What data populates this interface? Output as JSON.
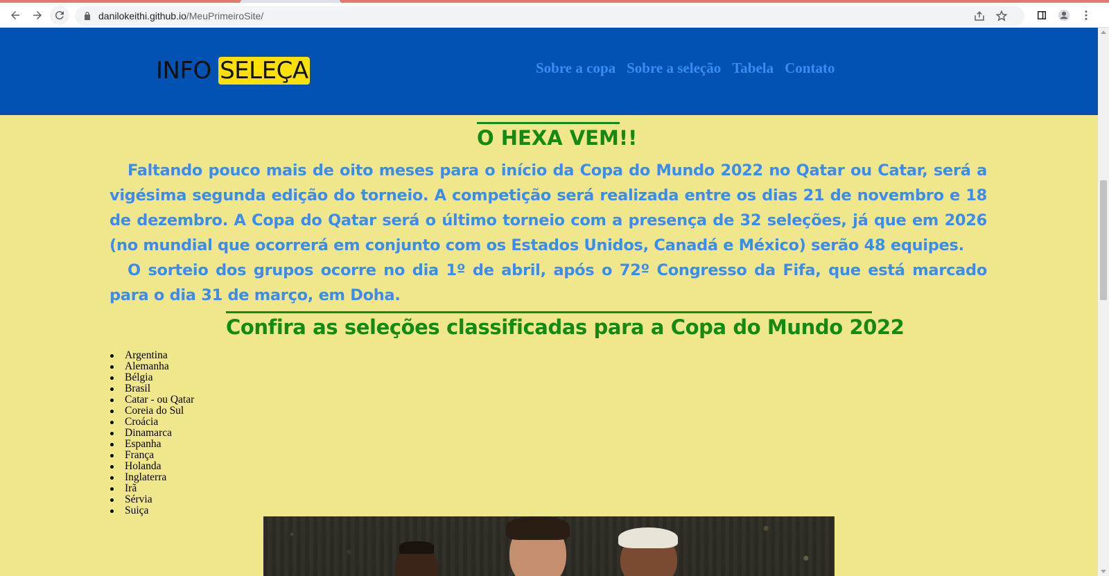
{
  "browser": {
    "url_host": "danilokeithi.github.io",
    "url_path": "/MeuPrimeiroSite/",
    "icons": [
      "back-icon",
      "forward-icon",
      "reload-icon",
      "lock-icon",
      "share-icon",
      "star-icon",
      "side-panel-icon",
      "profile-icon",
      "menu-icon"
    ]
  },
  "header": {
    "logo_plain": "INFO",
    "logo_highlight": "SELEÇA",
    "nav": [
      "Sobre a copa",
      "Sobre a seleção",
      "Tabela",
      "Contato"
    ]
  },
  "main": {
    "heading": "O HEXA VEM!!",
    "paragraphs": [
      "Faltando pouco mais de oito meses para o início da Copa do Mundo 2022 no Qatar ou Catar, será a vigésima segunda edição do torneio. A competição será realizada entre os dias 21 de novembro e 18 de dezembro. A Copa do Qatar será o último torneio com a presença de 32 seleções, já que em 2026 (no mundial que ocorrerá em conjunto com os Estados Unidos, Canadá e México) serão 48 equipes.",
      "O sorteio dos grupos ocorre no dia 1º de abril, após o 72º Congresso da Fifa, que está marcado para o dia 31 de março, em Doha."
    ],
    "subheading": "Confira as seleções classificadas para a Copa do Mundo 2022",
    "teams": [
      "Argentina",
      "Alemanha",
      "Bélgia",
      "Brasil",
      "Catar - ou Qatar",
      "Coreia do Sul",
      "Croácia",
      "Dinamarca",
      "Espanha",
      "França",
      "Holanda",
      "Inglaterra",
      "Irã",
      "Sérvia",
      "Suiça"
    ]
  },
  "colors": {
    "header_bg": "#0252b3",
    "page_bg": "#f0e68c",
    "accent_green": "#138a13",
    "text_blue": "#3a8cf3",
    "logo_highlight": "#ffe100"
  }
}
